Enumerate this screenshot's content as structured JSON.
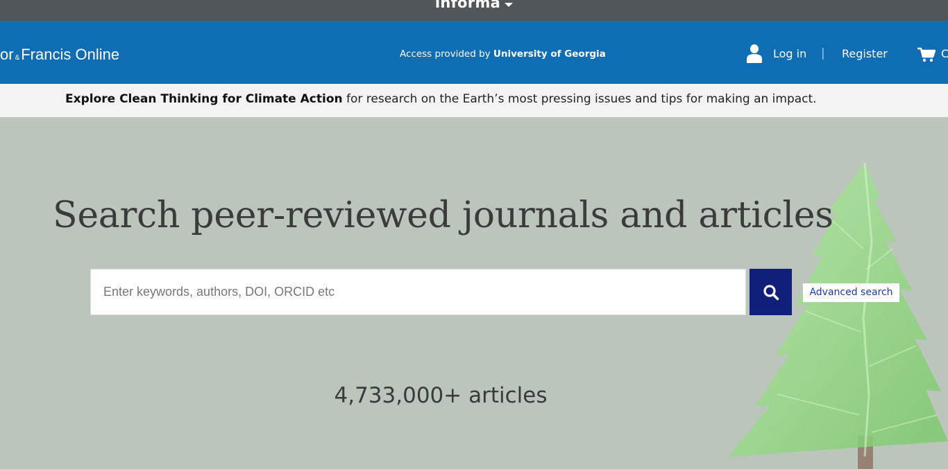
{
  "top_bar": {
    "label": "informa"
  },
  "header": {
    "brand": {
      "left": "or",
      "amp": "&",
      "right": "Francis Online"
    },
    "access_prefix": "Access provided by ",
    "access_institution": "University of Georgia",
    "login_label": "Log in",
    "separator": "|",
    "register_label": "Register",
    "cart_label_visible": "C"
  },
  "promo": {
    "bold_text": "Explore Clean Thinking for Climate Action",
    "rest_text": " for research on the Earth’s most pressing issues and tips for making an impact."
  },
  "hero": {
    "title": "Search peer-reviewed journals and articles",
    "search_placeholder": "Enter keywords, authors, DOI, ORCID etc",
    "search_icon": "search-icon",
    "advanced_search_label": "Advanced search",
    "article_count": "4,733,000+ articles"
  },
  "colors": {
    "informa_bar": "#505659",
    "header_blue": "#0f6db3",
    "promo_bg": "#f2f3f2",
    "hero_bg": "#bcc5bc",
    "search_button": "#10207a",
    "tree_green": "#8fd17f"
  }
}
